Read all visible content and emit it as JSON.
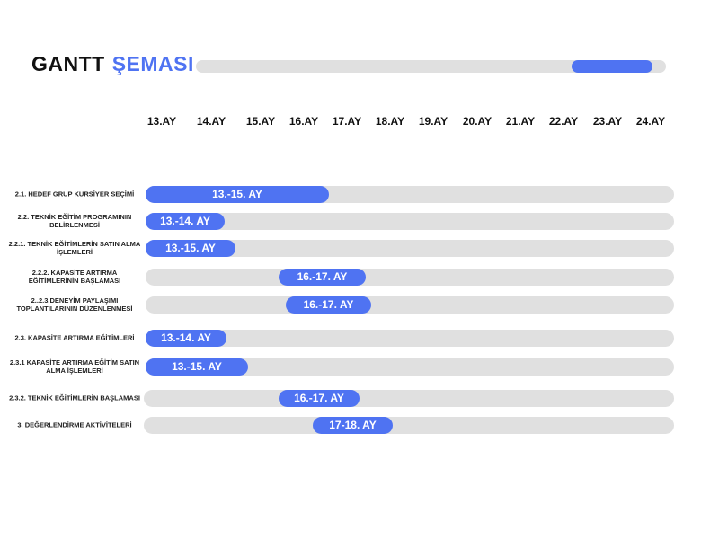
{
  "title": {
    "part1": "GANTT",
    "part2": "ŞEMASI"
  },
  "colors": {
    "accent": "#4f73f2",
    "track": "#e0e0e0",
    "text": "#111111"
  },
  "chart_data": {
    "type": "gantt",
    "months": [
      "13.AY",
      "14.AY",
      "15.AY",
      "16.AY",
      "17.AY",
      "18.AY",
      "19.AY",
      "20.AY",
      "21.AY",
      "22.AY",
      "23.AY",
      "24.AY"
    ],
    "tasks": [
      {
        "label": "2.1. HEDEF GRUP KURSİYER SEÇİMİ",
        "range": "13.-15. AY",
        "start": 13,
        "end": 15
      },
      {
        "label": "2.2. TEKNİK EĞİTİM PROGRAMININ BELİRLENMESİ",
        "range": "13.-14. AY",
        "start": 13,
        "end": 14
      },
      {
        "label": "2.2.1. TEKNİK EĞİTİMLERİN SATIN ALMA İŞLEMLERİ",
        "range": "13.-15. AY",
        "start": 13,
        "end": 15
      },
      {
        "label": "2.2.2. KAPASİTE ARTIRMA EĞİTİMLERİNİN BAŞLAMASI",
        "range": "16.-17. AY",
        "start": 16,
        "end": 17
      },
      {
        "label": "2..2.3.DENEYİM PAYLAŞIMI TOPLANTILARININ DÜZENLENMESİ",
        "range": "16.-17. AY",
        "start": 16,
        "end": 17
      },
      {
        "label": "2.3. KAPASİTE ARTIRMA EĞİTİMLERİ",
        "range": "13.-14. AY",
        "start": 13,
        "end": 14
      },
      {
        "label": "2.3.1 KAPASİTE ARTIRMA EĞİTİM SATIN ALMA İŞLEMLERİ",
        "range": "13.-15. AY",
        "start": 13,
        "end": 15
      },
      {
        "label": "2.3.2. TEKNİK EĞİTİMLERİN BAŞLAMASI",
        "range": "16.-17. AY",
        "start": 16,
        "end": 17
      },
      {
        "label": "3.  DEĞERLENDİRME AKTİVİTELERİ",
        "range": "17-18. AY",
        "start": 17,
        "end": 18
      }
    ]
  }
}
